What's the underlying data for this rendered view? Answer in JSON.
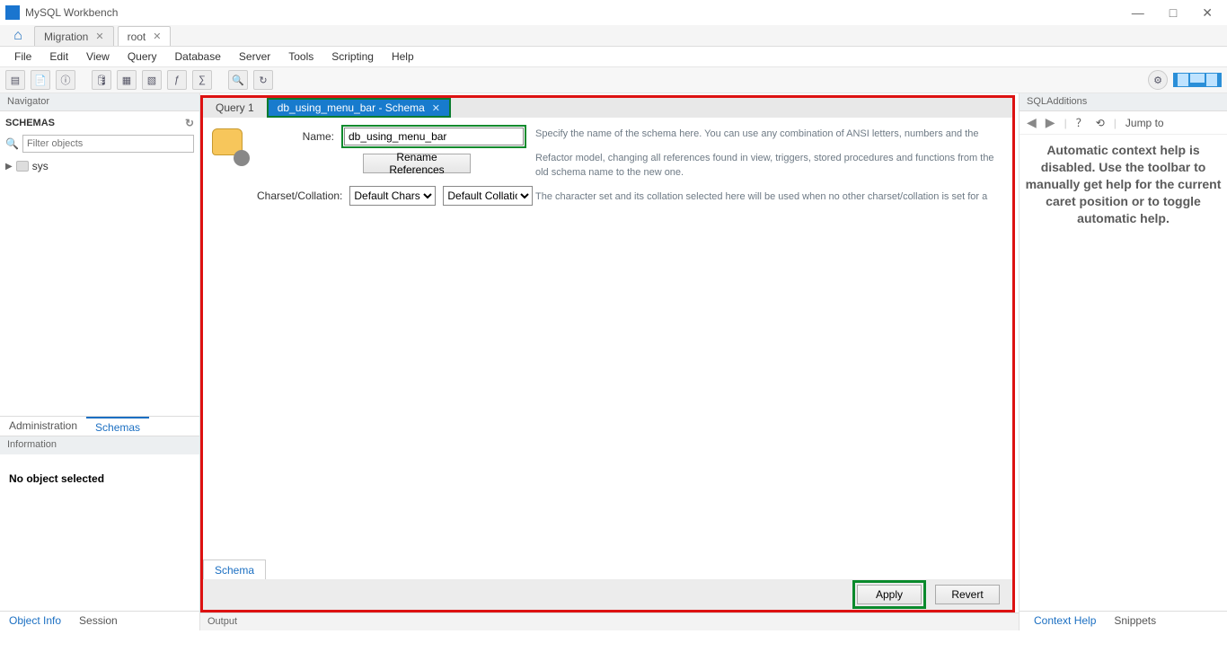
{
  "app": {
    "title": "MySQL Workbench"
  },
  "conn_tabs": {
    "migration": "Migration",
    "root": "root"
  },
  "menu": {
    "file": "File",
    "edit": "Edit",
    "view": "View",
    "query": "Query",
    "database": "Database",
    "server": "Server",
    "tools": "Tools",
    "scripting": "Scripting",
    "help": "Help"
  },
  "navigator": {
    "title": "Navigator",
    "schemas_label": "SCHEMAS",
    "filter_placeholder": "Filter objects",
    "tree": {
      "sys": "sys"
    },
    "tabs": {
      "admin": "Administration",
      "schemas": "Schemas"
    }
  },
  "information": {
    "title": "Information",
    "body": "No object selected",
    "tabs": {
      "object_info": "Object Info",
      "session": "Session"
    }
  },
  "editor_tabs": {
    "query1": "Query 1",
    "schema_tab": "db_using_menu_bar - Schema"
  },
  "schema_form": {
    "name_label": "Name:",
    "name_value": "db_using_menu_bar",
    "rename_btn": "Rename References",
    "charset_label": "Charset/Collation:",
    "charset_value": "Default Charset",
    "collation_value": "Default Collation",
    "desc1": "Specify the name of the schema here. You can use any combination of ANSI letters, numbers and the",
    "desc2": "Refactor model, changing all references found in view, triggers, stored procedures and functions from the old schema name to the new one.",
    "desc3": "The character set and its collation selected here will be used when no other charset/collation is set for a",
    "bottom_tab": "Schema"
  },
  "buttons": {
    "apply": "Apply",
    "revert": "Revert"
  },
  "output": {
    "title": "Output"
  },
  "sql_additions": {
    "title": "SQLAdditions",
    "jump": "Jump to",
    "body": "Automatic context help is disabled. Use the toolbar to manually get help for the current caret position or to toggle automatic help.",
    "tabs": {
      "context": "Context Help",
      "snippets": "Snippets"
    }
  }
}
